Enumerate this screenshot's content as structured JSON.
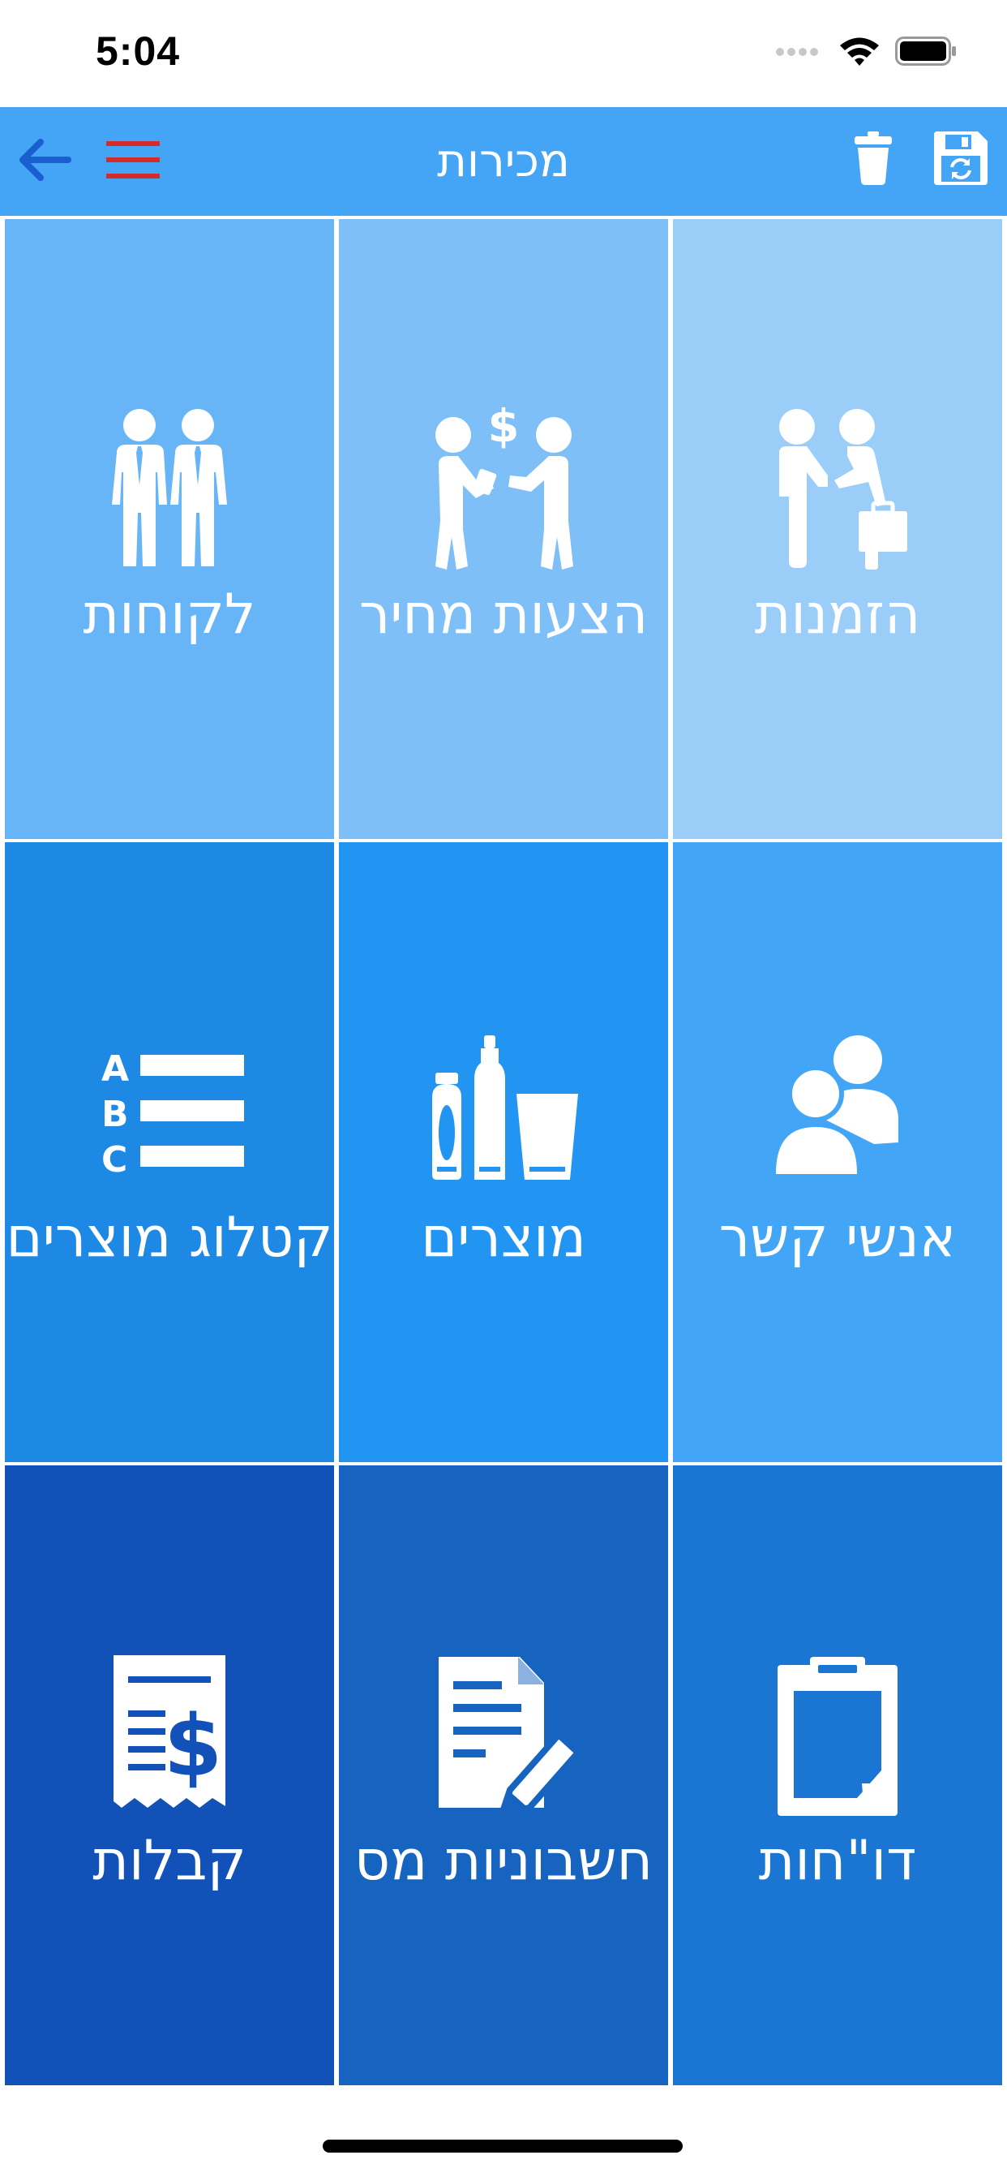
{
  "status_bar": {
    "time": "5:04"
  },
  "nav": {
    "title": "מכירות",
    "back_icon": "arrow-left-icon",
    "menu_icon": "hamburger-menu-icon",
    "delete_icon": "trash-icon",
    "save_icon": "save-sync-icon"
  },
  "tiles": [
    {
      "label": "הזמנות",
      "icon": "handshake-briefcase-icon",
      "color": "#9acdf7"
    },
    {
      "label": "הצעות מחיר",
      "icon": "price-offer-exchange-icon",
      "color": "#7ebff8"
    },
    {
      "label": "לקוחות",
      "icon": "business-customers-icon",
      "color": "#67b4f7"
    },
    {
      "label": "אנשי קשר",
      "icon": "contacts-people-icon",
      "color": "#42a5f5"
    },
    {
      "label": "מוצרים",
      "icon": "products-bottles-icon",
      "color": "#2295f2"
    },
    {
      "label": "קטלוג מוצרים",
      "icon": "abc-catalog-list-icon",
      "color": "#1e88e5"
    },
    {
      "label": "דו\"חות",
      "icon": "clipboard-reports-icon",
      "color": "#1b76d3"
    },
    {
      "label": "חשבוניות מס",
      "icon": "invoice-document-pen-icon",
      "color": "#1664c0"
    },
    {
      "label": "קבלות",
      "icon": "receipt-dollar-icon",
      "color": "#1251b8"
    }
  ],
  "colors": {
    "nav_background": "#44a4f5",
    "back_arrow": "#1a5fd0",
    "menu_lines": "#d62b2b"
  }
}
